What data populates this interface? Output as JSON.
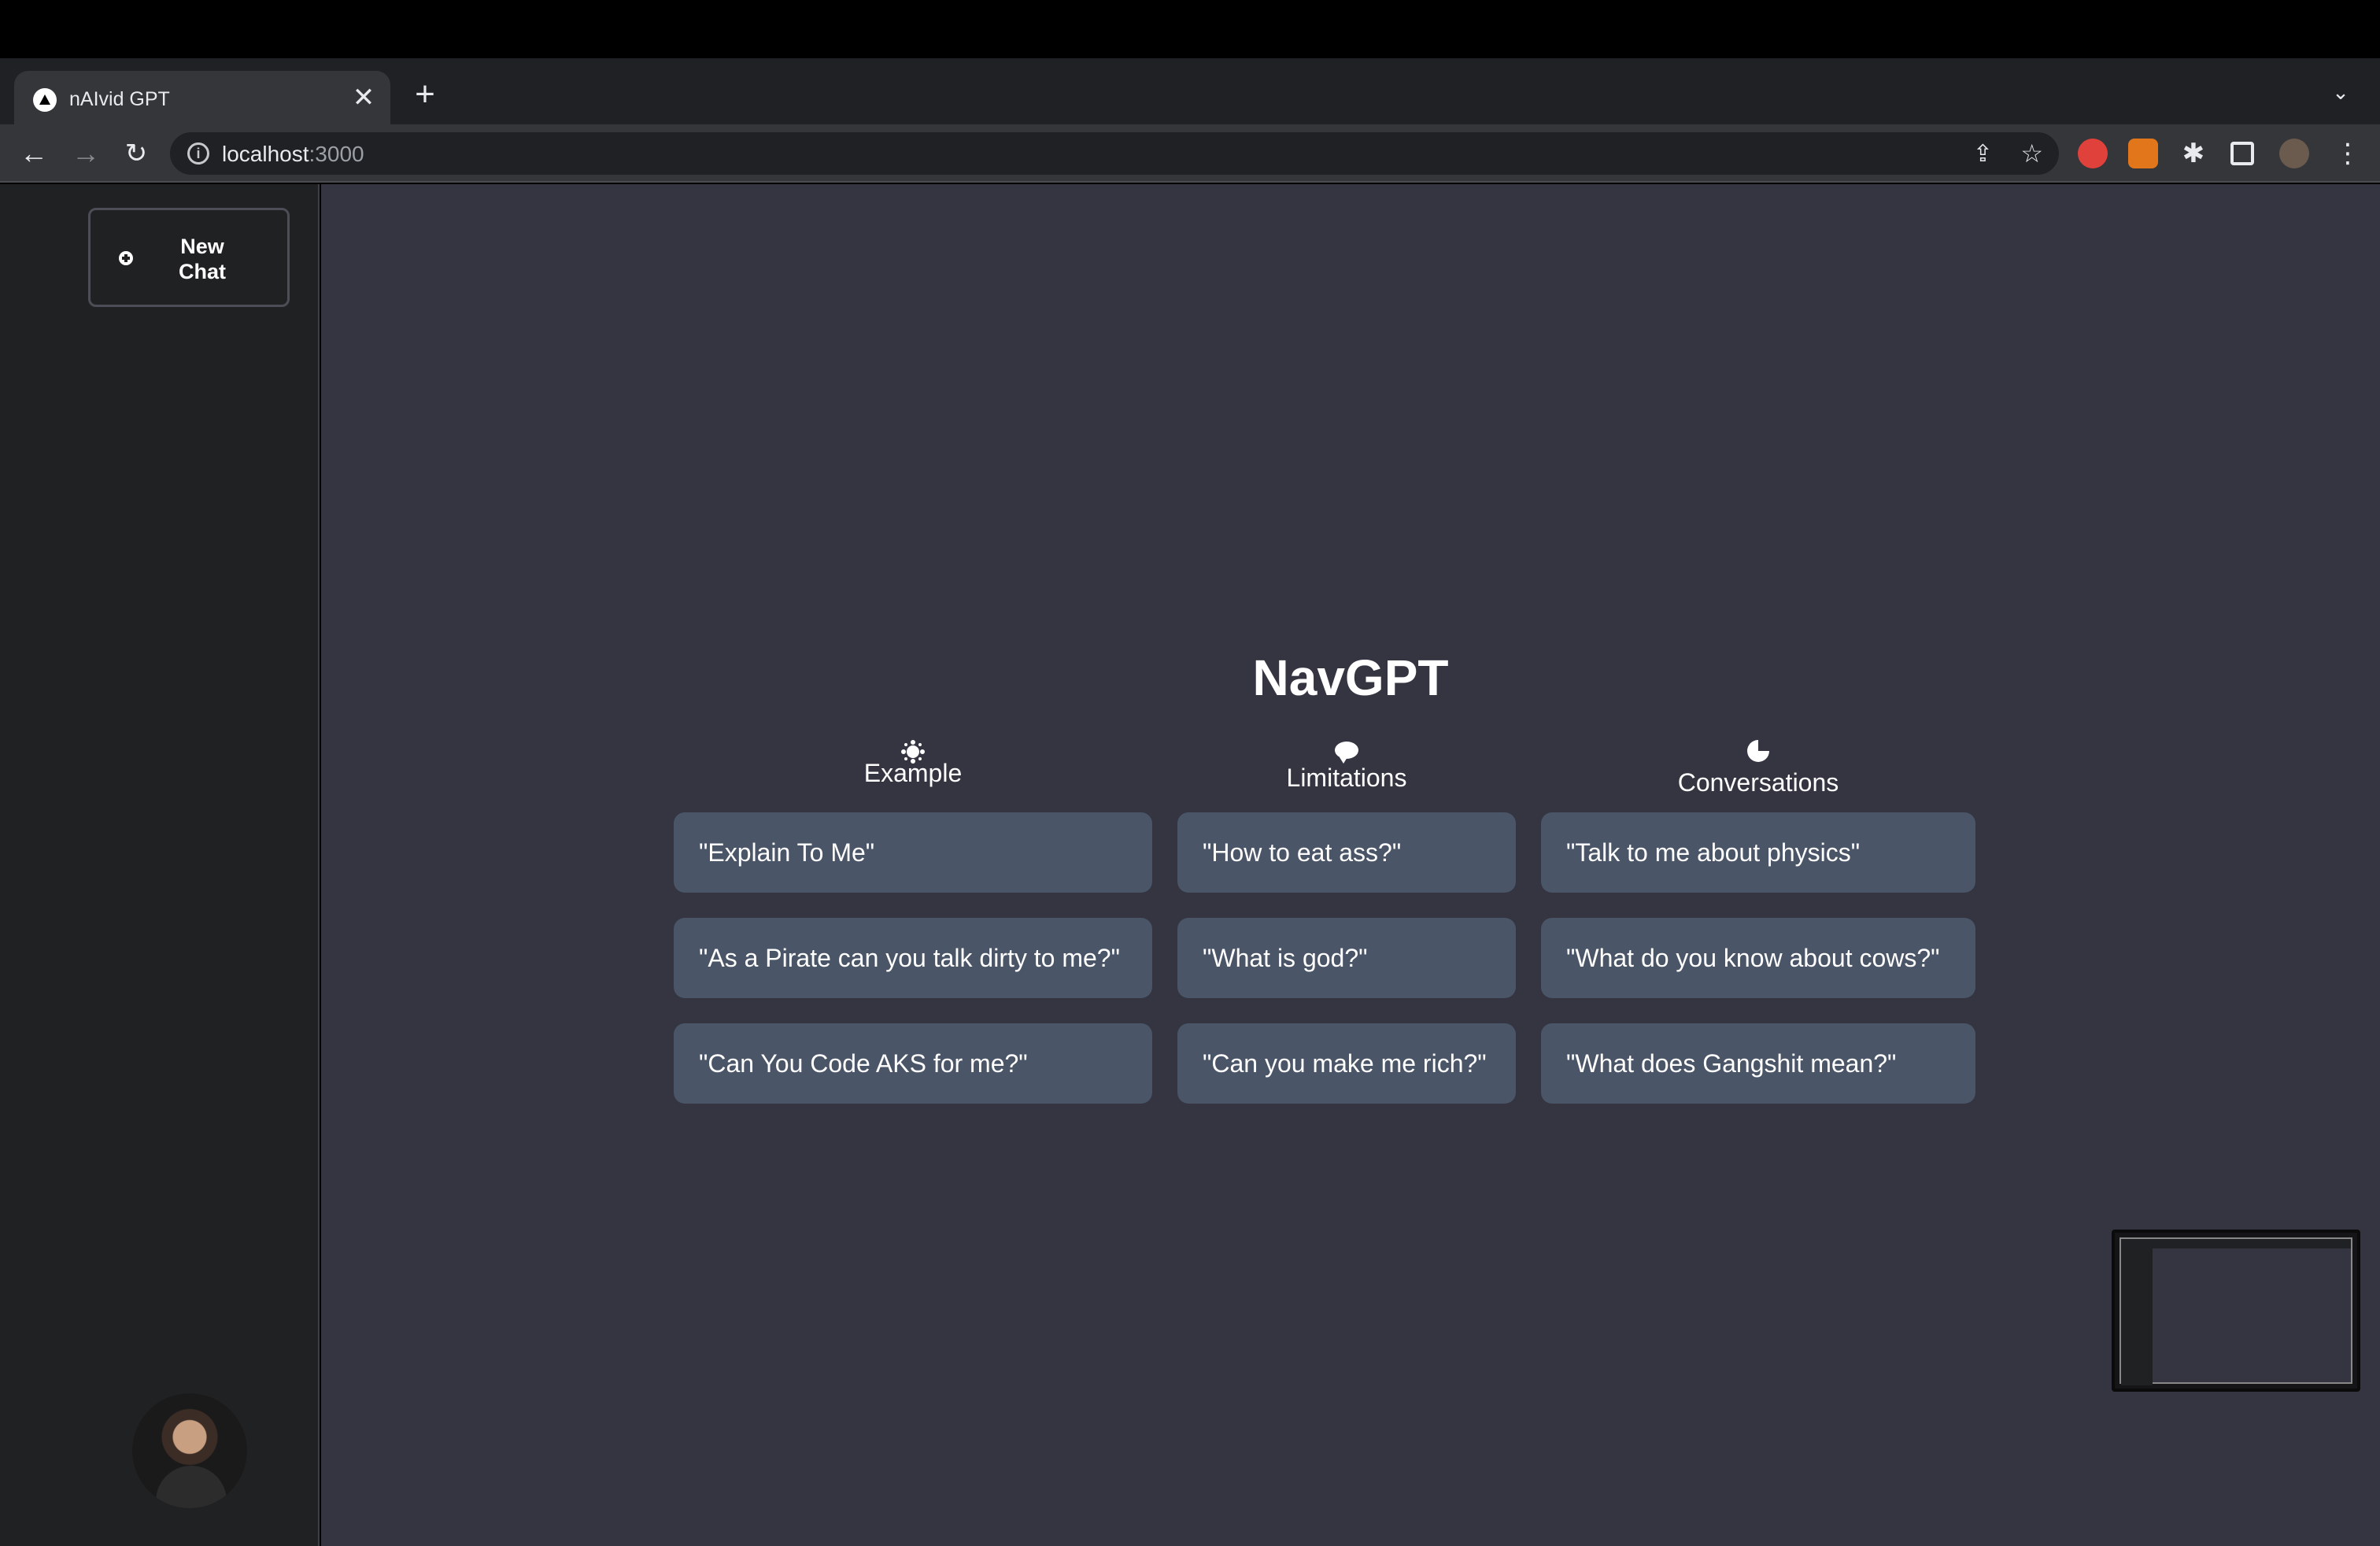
{
  "browser": {
    "tab_title": "nAIvid GPT",
    "url_host": "localhost",
    "url_port": ":3000",
    "tab_close": "✕",
    "new_tab": "+",
    "tab_search": "⌄"
  },
  "sidebar": {
    "new_chat_label": "New Chat"
  },
  "main": {
    "title": "NavGPT",
    "columns": [
      {
        "heading": "Example",
        "icon": "sun-icon",
        "items": [
          "\"Explain To Me\"",
          "\"As a Pirate can you talk dirty to me?\"",
          "\"Can You Code AKS for me?\""
        ]
      },
      {
        "heading": "Limitations",
        "icon": "talk-bubble-icon",
        "items": [
          "\"How to eat ass?\"",
          "\"What is god?\"",
          "\"Can you make me rich?\""
        ]
      },
      {
        "heading": "Conversations",
        "icon": "pie-chart-icon",
        "items": [
          "\"Talk to me about physics\"",
          "\"What do you know about cows?\"",
          "\"What does Gangshit mean?\""
        ]
      }
    ]
  },
  "colors": {
    "sidebar_bg": "#202123",
    "main_bg": "#343541",
    "card_bg": "#4a5568"
  }
}
